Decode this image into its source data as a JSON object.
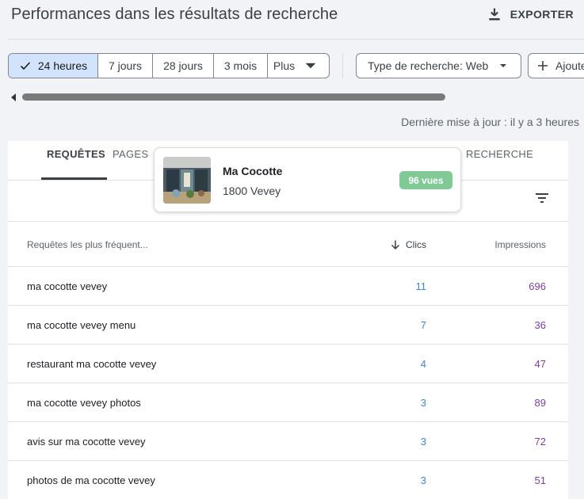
{
  "header": {
    "title": "Performances dans les résultats de recherche",
    "export_label": "EXPORTER"
  },
  "filters": {
    "periods": [
      {
        "label": "24 heures",
        "selected": true
      },
      {
        "label": "7 jours"
      },
      {
        "label": "28 jours"
      },
      {
        "label": "3 mois"
      },
      {
        "label": "Plus"
      }
    ],
    "search_type_label": "Type de recherche: Web",
    "add_label": "Ajoute"
  },
  "status": {
    "last_update": "Dernière mise à jour : il y a 3 heures"
  },
  "tabs": [
    {
      "label": "REQUÊTES",
      "active": true
    },
    {
      "label": "PAGES"
    },
    {
      "label": "RECHERCHE"
    }
  ],
  "popup": {
    "name": "Ma Cocotte",
    "address": "1800 Vevey",
    "badge": "96 vues"
  },
  "table": {
    "columns": {
      "query": "Requêtes les plus fréquent...",
      "clicks": "Clics",
      "impressions": "Impressions"
    },
    "rows": [
      {
        "query": "ma cocotte vevey",
        "clicks": "11",
        "impressions": "696"
      },
      {
        "query": "ma cocotte vevey menu",
        "clicks": "7",
        "impressions": "36"
      },
      {
        "query": "restaurant ma cocotte vevey",
        "clicks": "4",
        "impressions": "47"
      },
      {
        "query": "ma cocotte vevey photos",
        "clicks": "3",
        "impressions": "89"
      },
      {
        "query": "avis sur ma cocotte vevey",
        "clicks": "3",
        "impressions": "72"
      },
      {
        "query": "photos de ma cocotte vevey",
        "clicks": "3",
        "impressions": "51"
      }
    ]
  },
  "colors": {
    "selected_chip": "#d2e3fc",
    "clicks": "#4285c6",
    "impressions": "#7b3fa0",
    "badge": "#81c995"
  }
}
